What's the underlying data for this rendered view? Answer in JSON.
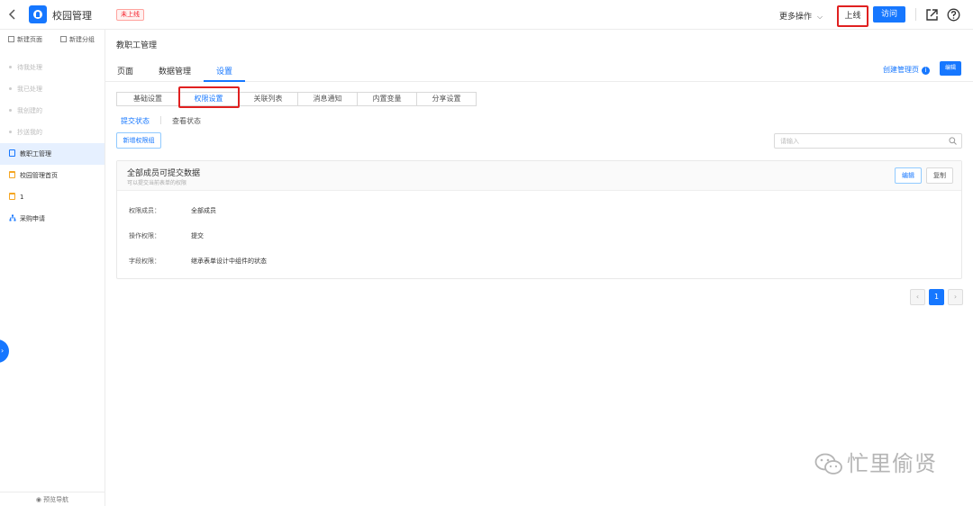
{
  "topbar": {
    "app_title": "校园管理",
    "status_badge": "未上线",
    "more_actions": "更多操作",
    "online_button": "上线",
    "visit_button": "访问"
  },
  "sidebar": {
    "new_page": "新建页面",
    "new_group": "新建分组",
    "muted_items": [
      "待我处理",
      "我已处理",
      "我创建的",
      "抄送我的"
    ],
    "items": [
      {
        "label": "教职工管理",
        "icon": "document-icon",
        "active": true
      },
      {
        "label": "校园管理首页",
        "icon": "calendar-icon",
        "active": false
      },
      {
        "label": "1",
        "icon": "calendar-icon",
        "active": false
      },
      {
        "label": "采购申请",
        "icon": "org-chart-icon",
        "active": false
      }
    ],
    "footer": "预览导航"
  },
  "main": {
    "page_title": "教职工管理",
    "tabs": [
      "页面",
      "数据管理",
      "设置"
    ],
    "active_tab": "设置",
    "create_admin_link": "创建管理页",
    "edit_button": "编辑",
    "sub_tabs": [
      "基础设置",
      "权限设置",
      "关联列表",
      "消息通知",
      "内置变量",
      "分享设置"
    ],
    "active_sub_tab": "权限设置",
    "state_tabs": [
      "提交状态",
      "查看状态"
    ],
    "active_state_tab": "提交状态",
    "new_permission_group": "新增权限组",
    "search_placeholder": "请输入"
  },
  "card": {
    "title": "全部成员可提交数据",
    "subtitle": "可以提交当前表单的权限",
    "edit_button": "编辑",
    "copy_button": "复制",
    "rows": [
      {
        "label": "权限成员：",
        "value": "全部成员"
      },
      {
        "label": "操作权限：",
        "value": "提交"
      },
      {
        "label": "字段权限：",
        "value": "继承表单设计中组件的状态"
      }
    ]
  },
  "pagination": {
    "prev": "‹",
    "current": "1",
    "next": "›"
  },
  "watermark": "忙里偷贤",
  "colors": {
    "primary": "#1677ff",
    "highlight": "#e02020",
    "badge_red": "#f5222d"
  }
}
